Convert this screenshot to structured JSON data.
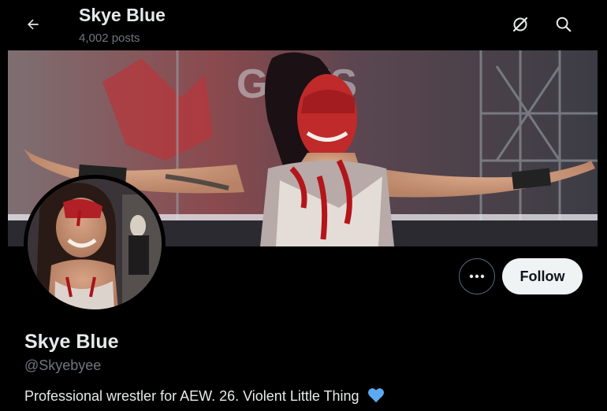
{
  "header": {
    "name": "Skye Blue",
    "posts": "4,002 posts"
  },
  "actions": {
    "follow_label": "Follow"
  },
  "profile": {
    "display_name": "Skye Blue",
    "handle": "@Skyebyee",
    "bio": "Professional wrestler for AEW. 26. Violent Little Thing",
    "bio_emoji": "blue-heart-icon"
  },
  "banner": {
    "sign_text": "GIFTS"
  },
  "colors": {
    "background": "#000000",
    "text_primary": "#e7e9ea",
    "text_secondary": "#71767b",
    "follow_bg": "#eff3f4",
    "follow_text": "#0f1419",
    "border": "#536471",
    "heart": "#5da9f0"
  },
  "icons": {
    "back": "back-arrow-icon",
    "grok": "grok-icon",
    "search": "search-icon",
    "more": "more-icon"
  }
}
